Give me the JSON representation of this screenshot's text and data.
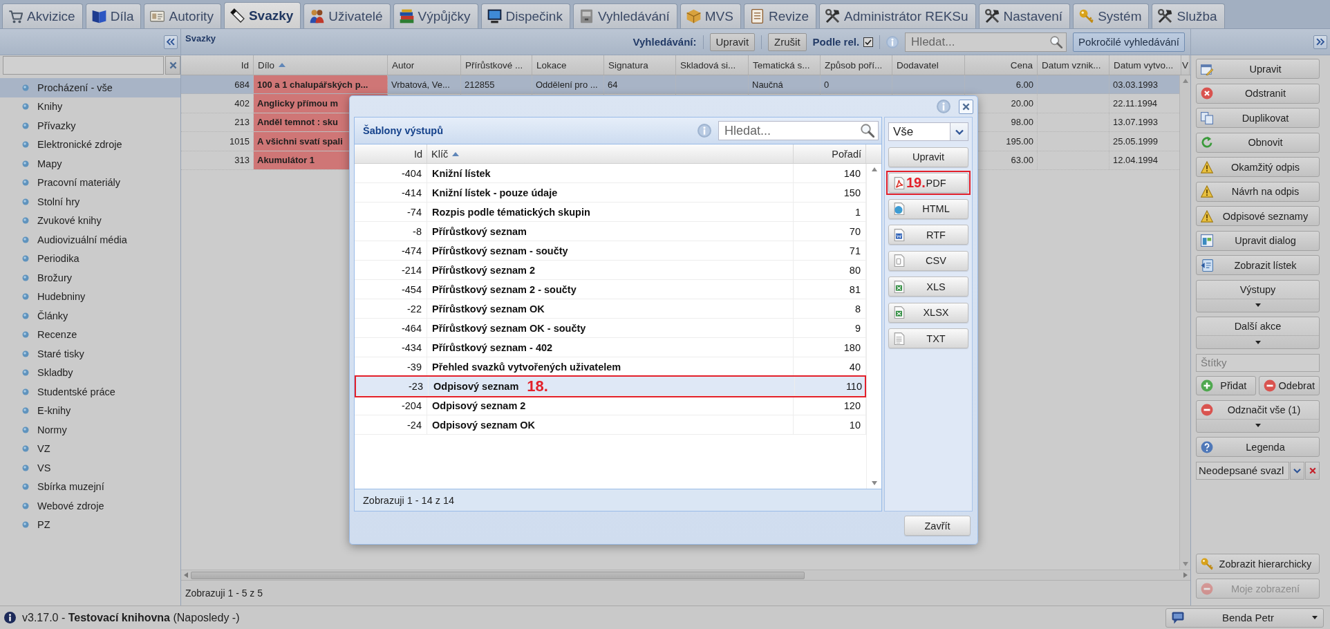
{
  "tabs": [
    {
      "label": "Akvizice",
      "selected": false
    },
    {
      "label": "Díla",
      "selected": false
    },
    {
      "label": "Autority",
      "selected": false
    },
    {
      "label": "Svazky",
      "selected": true
    },
    {
      "label": "Uživatelé",
      "selected": false
    },
    {
      "label": "Výpůjčky",
      "selected": false
    },
    {
      "label": "Dispečink",
      "selected": false
    },
    {
      "label": "Vyhledávání",
      "selected": false
    },
    {
      "label": "MVS",
      "selected": false
    },
    {
      "label": "Revize",
      "selected": false
    },
    {
      "label": "Administrátor REKSu",
      "selected": false
    },
    {
      "label": "Nastavení",
      "selected": false
    },
    {
      "label": "Systém",
      "selected": false
    },
    {
      "label": "Služba",
      "selected": false
    }
  ],
  "sidebar": {
    "items": [
      {
        "label": "Procházení - vše",
        "selected": true
      },
      {
        "label": "Knihy",
        "selected": false
      },
      {
        "label": "Přívazky",
        "selected": false
      },
      {
        "label": "Elektronické zdroje",
        "selected": false
      },
      {
        "label": "Mapy",
        "selected": false
      },
      {
        "label": "Pracovní materiály",
        "selected": false
      },
      {
        "label": "Stolní hry",
        "selected": false
      },
      {
        "label": "Zvukové knihy",
        "selected": false
      },
      {
        "label": "Audiovizuální média",
        "selected": false
      },
      {
        "label": "Periodika",
        "selected": false
      },
      {
        "label": "Brožury",
        "selected": false
      },
      {
        "label": "Hudebniny",
        "selected": false
      },
      {
        "label": "Články",
        "selected": false
      },
      {
        "label": "Recenze",
        "selected": false
      },
      {
        "label": "Staré tisky",
        "selected": false
      },
      {
        "label": "Skladby",
        "selected": false
      },
      {
        "label": "Studentské práce",
        "selected": false
      },
      {
        "label": "E-knihy",
        "selected": false
      },
      {
        "label": "Normy",
        "selected": false
      },
      {
        "label": "VZ",
        "selected": false
      },
      {
        "label": "VS",
        "selected": false
      },
      {
        "label": "Sbírka muzejní",
        "selected": false
      },
      {
        "label": "Webové zdroje",
        "selected": false
      },
      {
        "label": "PZ",
        "selected": false
      }
    ]
  },
  "grid": {
    "title": "Svazky",
    "search_label": "Vyhledávání:",
    "buttons": [
      {
        "label": "Upravit"
      },
      {
        "label": "Zrušit"
      }
    ],
    "relevance": {
      "label": "Podle rel.",
      "checked": true
    },
    "search": {
      "placeholder": "Hledat..."
    },
    "advanced_search": {
      "label": "Pokročilé vyhledávání",
      "pressed": true
    },
    "columns": [
      {
        "label": "Id",
        "kind": "number",
        "sorted": false
      },
      {
        "label": "Dílo",
        "kind": "title",
        "sorted": true
      },
      {
        "label": "Autor",
        "kind": "text",
        "sorted": false
      },
      {
        "label": "Přírůstkové ...",
        "kind": "text",
        "sorted": false
      },
      {
        "label": "Lokace",
        "kind": "text",
        "sorted": false
      },
      {
        "label": "Signatura",
        "kind": "text",
        "sorted": false
      },
      {
        "label": "Skladová si...",
        "kind": "text",
        "sorted": false
      },
      {
        "label": "Tematická s...",
        "kind": "text",
        "sorted": false
      },
      {
        "label": "Způsob poří...",
        "kind": "text",
        "sorted": false
      },
      {
        "label": "Dodavatel",
        "kind": "text",
        "sorted": false
      },
      {
        "label": "Cena",
        "kind": "number",
        "sorted": false
      },
      {
        "label": "Datum vznik...",
        "kind": "text",
        "sorted": false
      },
      {
        "label": "Datum vytvo...",
        "kind": "text",
        "sorted": false
      },
      {
        "label": "V",
        "kind": "text",
        "sorted": false
      }
    ],
    "rows": [
      {
        "selected": true,
        "highlighted": true,
        "cells": [
          "684",
          "100 a 1 chalupářských p...",
          "Vrbatová, Ve...",
          "212855",
          "Oddělení pro ...",
          "64",
          null,
          "Naučná",
          "0",
          null,
          "6.00",
          null,
          "03.03.1993",
          null
        ]
      },
      {
        "selected": false,
        "highlighted": true,
        "cells": [
          "402",
          "Anglicky přímou m",
          null,
          null,
          null,
          null,
          null,
          null,
          null,
          null,
          "20.00",
          null,
          "22.11.1994",
          null
        ]
      },
      {
        "selected": false,
        "highlighted": true,
        "cells": [
          "213",
          "Anděl temnot : sku",
          null,
          null,
          null,
          null,
          null,
          null,
          null,
          null,
          "98.00",
          null,
          "13.07.1993",
          null
        ]
      },
      {
        "selected": false,
        "highlighted": true,
        "cells": [
          "1015",
          "A všichni svatí spali",
          null,
          null,
          null,
          null,
          null,
          null,
          null,
          null,
          "195.00",
          null,
          "25.05.1999",
          null
        ]
      },
      {
        "selected": false,
        "highlighted": true,
        "cells": [
          "313",
          "Akumulátor 1",
          null,
          null,
          null,
          null,
          null,
          null,
          null,
          null,
          "63.00",
          null,
          "12.04.1994",
          null
        ]
      }
    ],
    "footer": "Zobrazuji 1 - 5 z 5"
  },
  "right_panel": {
    "actions": [
      {
        "kind": "button",
        "label": "Upravit"
      },
      {
        "kind": "button",
        "label": "Odstranit"
      },
      {
        "kind": "button",
        "label": "Duplikovat"
      },
      {
        "kind": "button",
        "label": "Obnovit"
      },
      {
        "kind": "button",
        "label": "Okamžitý odpis"
      },
      {
        "kind": "button",
        "label": "Návrh na odpis"
      },
      {
        "kind": "button",
        "label": "Odpisové seznamy"
      },
      {
        "kind": "button",
        "label": "Upravit dialog"
      },
      {
        "kind": "button",
        "label": "Zobrazit lístek"
      },
      {
        "kind": "menu",
        "label": "Výstupy"
      },
      {
        "kind": "menu",
        "label": "Další akce"
      },
      {
        "kind": "field",
        "placeholder": "Štítky"
      },
      {
        "kind": "pair",
        "buttons": [
          {
            "label": "Přidat"
          },
          {
            "label": "Odebrat"
          }
        ]
      },
      {
        "kind": "menu",
        "label": "Odznačit vše (1)"
      },
      {
        "kind": "button",
        "label": "Legenda"
      },
      {
        "kind": "combo",
        "value": "Neodepsané svazl"
      }
    ],
    "bottom_actions": [
      {
        "label": "Zobrazit hierarchicky",
        "disabled": false
      },
      {
        "label": "Moje zobrazení",
        "disabled": true
      }
    ]
  },
  "status_bar": {
    "version": "v3.17.0 - **Testovací knihovna** (Naposledy -)",
    "user": "Benda Petr"
  },
  "dialog": {
    "templates": {
      "title": "Šablony výstupů",
      "search": {
        "placeholder": "Hledat..."
      },
      "columns": [
        {
          "label": "Id",
          "kind": "number",
          "sorted": false
        },
        {
          "label": "Klíč",
          "kind": "key",
          "sorted": true
        },
        {
          "label": "Pořadí",
          "kind": "number",
          "sorted": false
        }
      ],
      "rows": [
        {
          "cells": [
            "-404",
            "Knižní lístek",
            "140"
          ],
          "selected": false
        },
        {
          "cells": [
            "-414",
            "Knižní lístek - pouze údaje",
            "150"
          ],
          "selected": false
        },
        {
          "cells": [
            "-74",
            "Rozpis podle tématických skupin",
            "1"
          ],
          "selected": false
        },
        {
          "cells": [
            "-8",
            "Přírůstkový seznam",
            "70"
          ],
          "selected": false
        },
        {
          "cells": [
            "-474",
            "Přírůstkový seznam - součty",
            "71"
          ],
          "selected": false
        },
        {
          "cells": [
            "-214",
            "Přírůstkový seznam 2",
            "80"
          ],
          "selected": false
        },
        {
          "cells": [
            "-454",
            "Přírůstkový seznam 2 - součty",
            "81"
          ],
          "selected": false
        },
        {
          "cells": [
            "-22",
            "Přírůstkový seznam OK",
            "8"
          ],
          "selected": false
        },
        {
          "cells": [
            "-464",
            "Přírůstkový seznam OK - součty",
            "9"
          ],
          "selected": false
        },
        {
          "cells": [
            "-434",
            "Přírůstkový seznam - 402",
            "180"
          ],
          "selected": false
        },
        {
          "cells": [
            "-39",
            "Přehled svazků vytvořených uživatelem",
            "40"
          ],
          "selected": false
        },
        {
          "cells": [
            "-23",
            "Odpisový seznam",
            "110"
          ],
          "selected": true,
          "callout": "18."
        },
        {
          "cells": [
            "-204",
            "Odpisový seznam 2",
            "120"
          ],
          "selected": false
        },
        {
          "cells": [
            "-24",
            "Odpisový seznam OK",
            "10"
          ],
          "selected": false
        }
      ],
      "footer": "Zobrazuji 1 - 14 z 14"
    },
    "filter": {
      "value": "Vše"
    },
    "actions": [
      {
        "label": "Upravit"
      },
      {
        "label": "PDF",
        "callout": "19."
      },
      {
        "label": "HTML"
      },
      {
        "label": "RTF"
      },
      {
        "label": "CSV"
      },
      {
        "label": "XLS"
      },
      {
        "label": "XLSX"
      },
      {
        "label": "TXT"
      }
    ],
    "close_button": "Zavřít"
  }
}
